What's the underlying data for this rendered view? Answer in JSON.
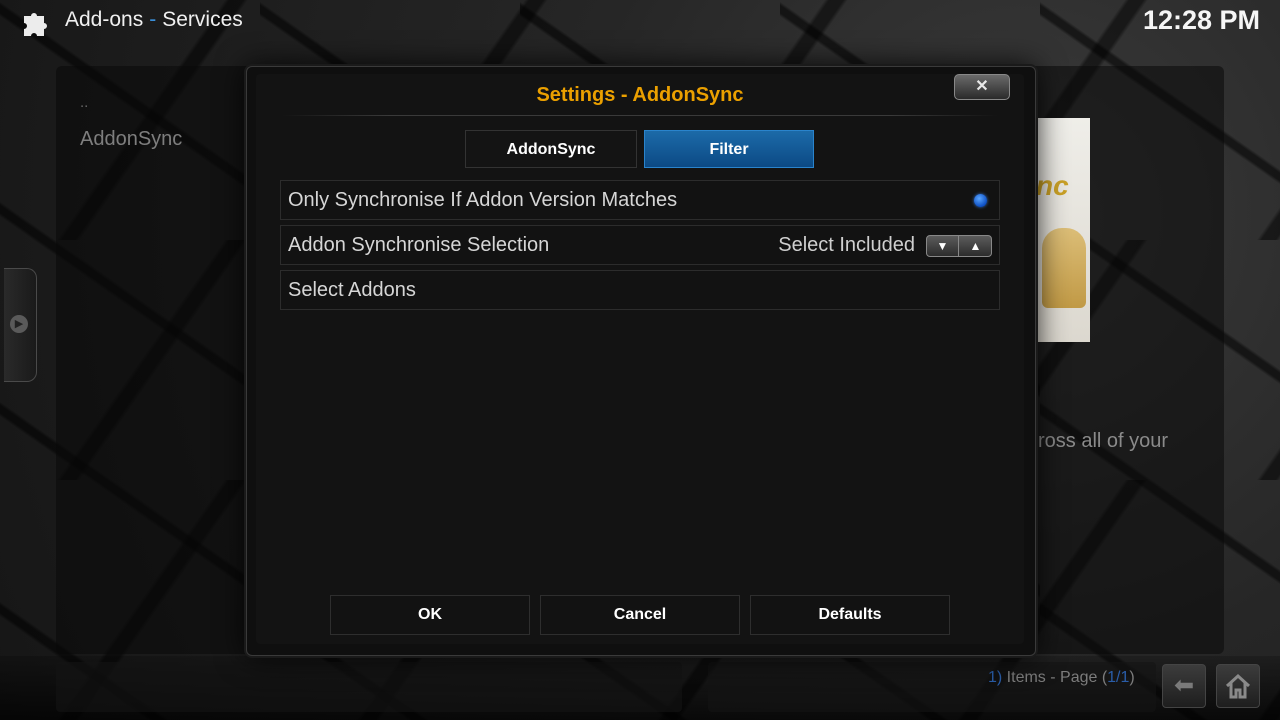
{
  "header": {
    "section": "Add-ons",
    "separator": "-",
    "subsection": "Services",
    "clock": "12:28 PM"
  },
  "background": {
    "parent_item": "..",
    "list_item": "AddonSync",
    "description_fragment": "cross all of your",
    "items_prefix": "1)",
    "items_text": " Items - Page (",
    "page": "1/1",
    "items_suffix": ")"
  },
  "dialog": {
    "title": "Settings - AddonSync",
    "close_label": "✕",
    "tabs": [
      {
        "label": "AddonSync",
        "active": false
      },
      {
        "label": "Filter",
        "active": true
      }
    ],
    "settings": [
      {
        "label": "Only Synchronise If Addon Version Matches",
        "type": "radio",
        "checked": true
      },
      {
        "label": "Addon Synchronise Selection",
        "type": "spinner",
        "value": "Select Included"
      },
      {
        "label": "Select Addons",
        "type": "action"
      }
    ],
    "buttons": {
      "ok": "OK",
      "cancel": "Cancel",
      "defaults": "Defaults"
    }
  },
  "colors": {
    "title": "#eba000",
    "accent": "#1c6aa8",
    "radio_on": "#0d4fc4"
  }
}
